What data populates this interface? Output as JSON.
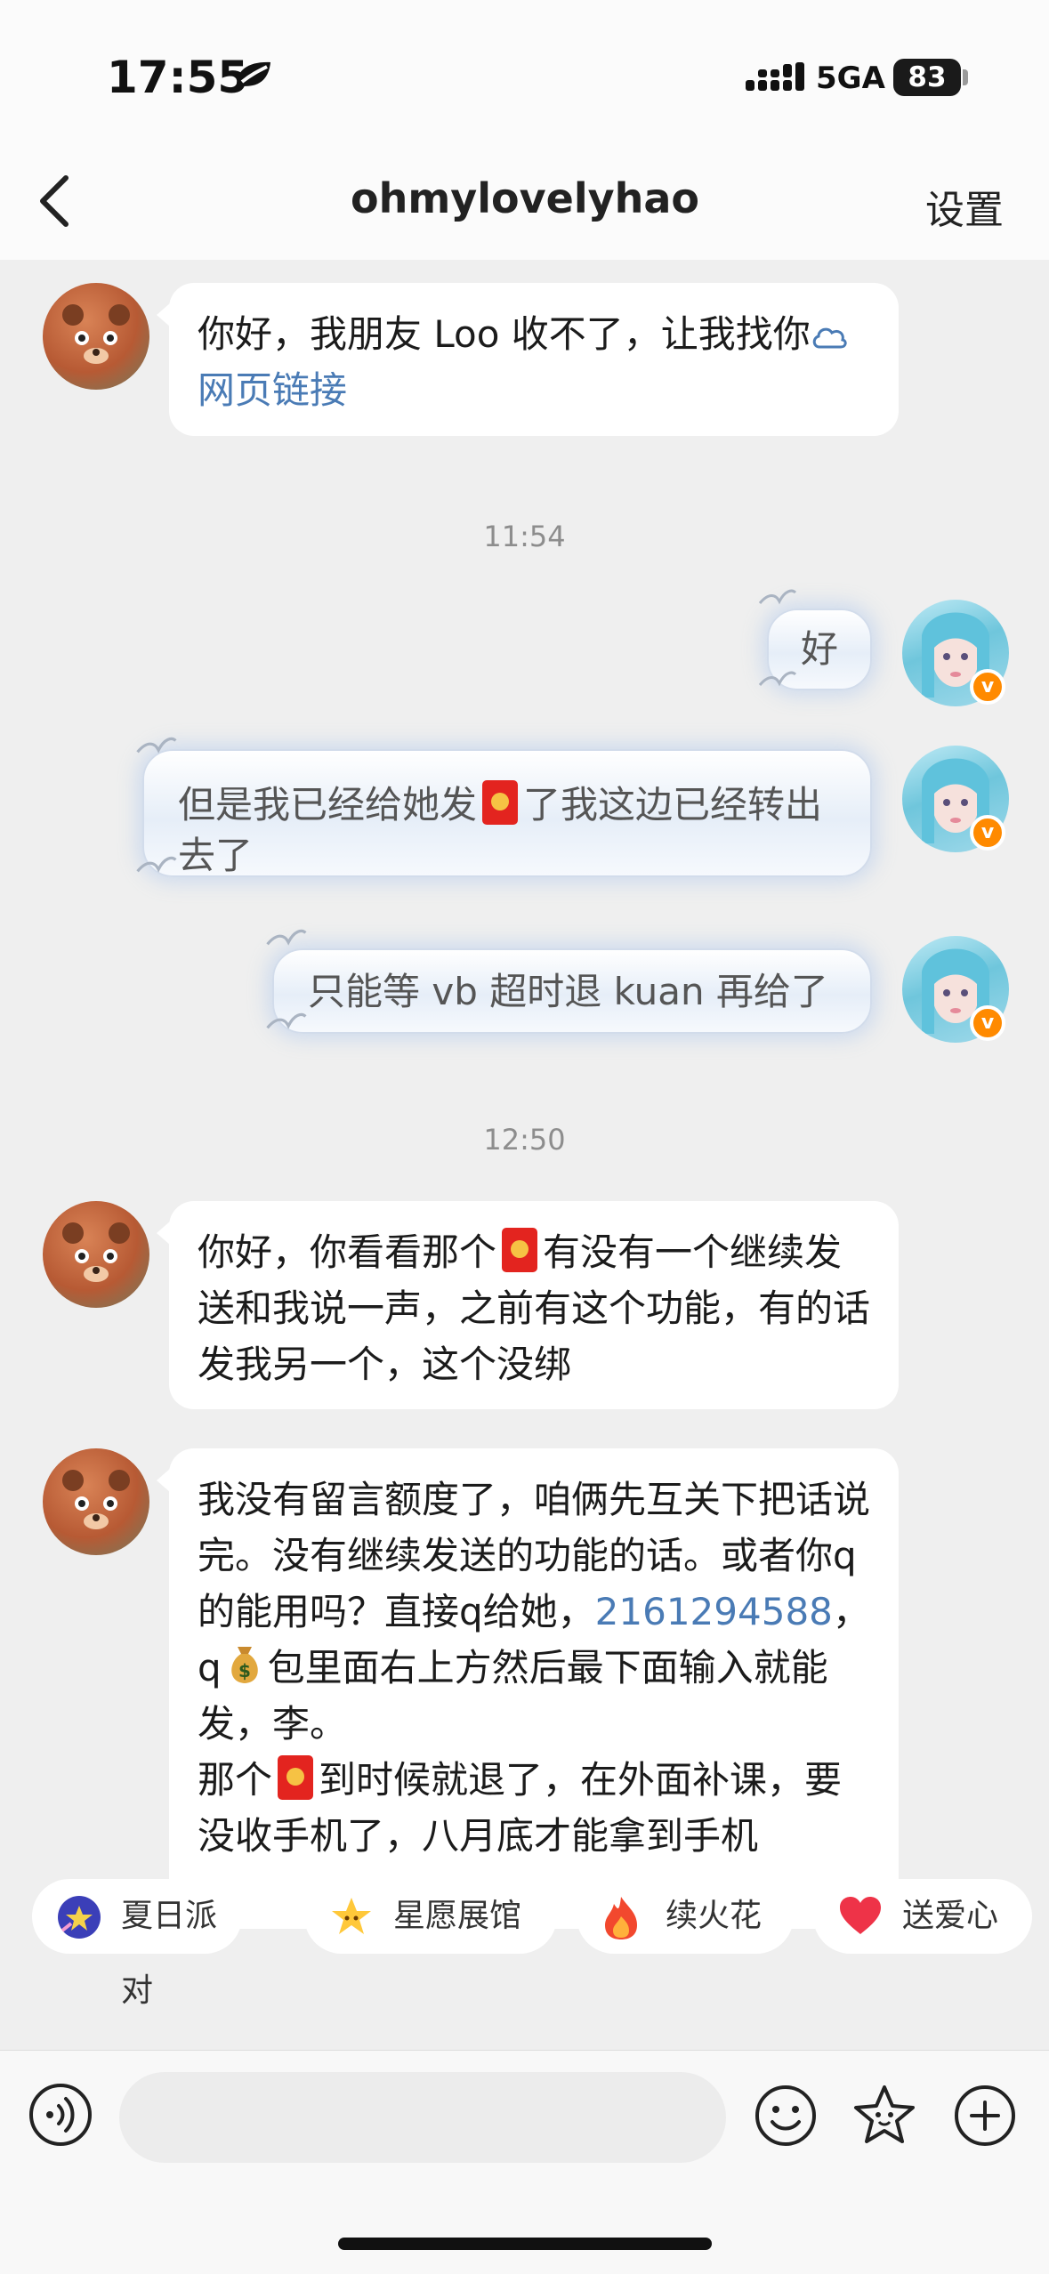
{
  "status_bar": {
    "time": "17:55",
    "network": "5GA",
    "battery": "83"
  },
  "header": {
    "title": "ohmylovelyhao",
    "settings_label": "设置"
  },
  "messages": {
    "m1": {
      "text": "你好，我朋友 Loo 收不了，让我找你",
      "link": "网页链接"
    },
    "ts1": "11:54",
    "m2": {
      "text": "好"
    },
    "m3": {
      "before": "但是我已经给她发",
      "after": "了我这边已经转出去了"
    },
    "m4": {
      "text": "只能等 vb 超时退 kuan 再给了"
    },
    "ts2": "12:50",
    "m5": {
      "before": "你好，你看看那个",
      "after": "有没有一个继续发送和我说一声，之前有这个功能，有的话发我另一个，这个没绑"
    },
    "m6": {
      "part1": "我没有留言额度了，咱俩先互关下把话说完。没有继续发送的功能的话。或者你q的能用吗？直接q给她，",
      "number": "2161294588",
      "part2": "，q",
      "part3": "包里面右上方然后最下面输入就能发，李。",
      "part4": "那个",
      "part5": "到时候就退了，在外面补课，要没收手机了，八月底才能拿到手机"
    }
  },
  "quick_actions": [
    "夏日派对",
    "星愿展馆",
    "续火花",
    "送爱心"
  ],
  "input": {
    "value": ""
  },
  "colors": {
    "link": "#4a7bb5",
    "hongbao": "#e3241f",
    "vip_badge": "#ff8a00",
    "background": "#efefef"
  }
}
